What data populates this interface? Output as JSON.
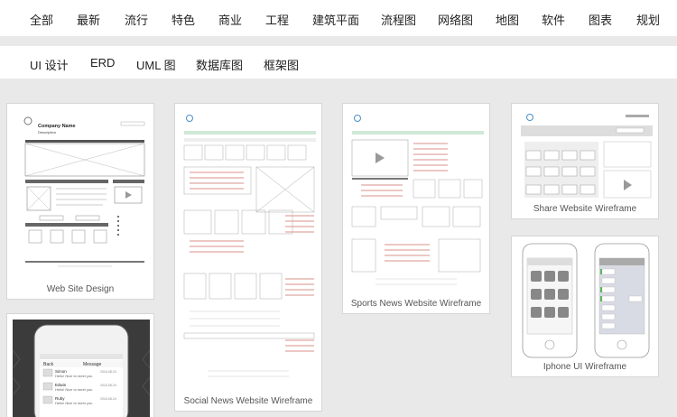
{
  "nav_primary": [
    "全部",
    "最新",
    "流行",
    "特色",
    "商业",
    "工程",
    "建筑平面",
    "流程图",
    "网络图",
    "地图",
    "软件",
    "图表",
    "规划"
  ],
  "nav_secondary": [
    "UI 设计",
    "ERD",
    "UML 图",
    "数据库图",
    "框架图"
  ],
  "cards": [
    {
      "caption": "Web Site Design",
      "company": "Company Name",
      "description": "Description"
    },
    {
      "caption": "Social News Website Wireframe"
    },
    {
      "caption": "Sports News Website Wireframe"
    },
    {
      "caption": "Share Website Wireframe"
    },
    {
      "caption": "Iphone UI Wireframe"
    },
    {
      "caption": "",
      "back": "Back",
      "message": "Message",
      "contacts": [
        {
          "name": "Simon",
          "text": "Hello! Nice to meet you",
          "date": "2016-08-24"
        },
        {
          "name": "Edwin",
          "text": "Hello! Nice to meet you",
          "date": "2016-08-24"
        },
        {
          "name": "Ruby",
          "text": "Hello! Nice to meet you",
          "date": "2016-08-24"
        }
      ]
    }
  ]
}
